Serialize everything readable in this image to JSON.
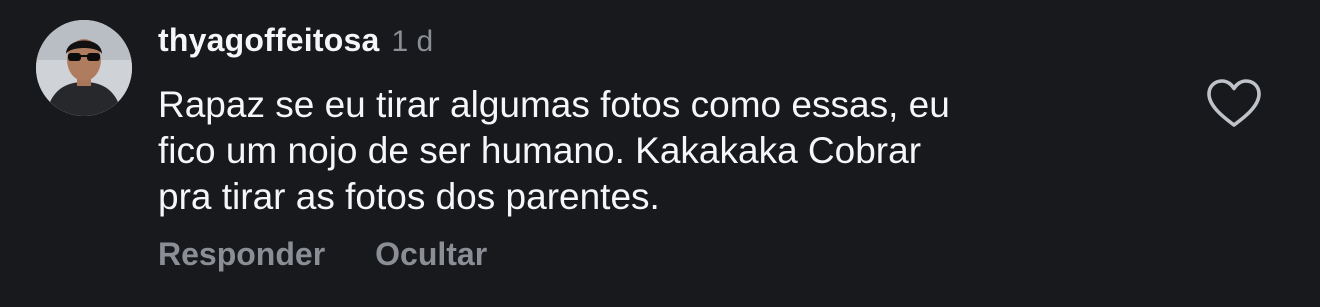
{
  "comment": {
    "username": "thyagoffeitosa",
    "time": "1 d",
    "text_lines": [
      "Rapaz se eu tirar algumas fotos como essas, eu",
      "fico um nojo de ser humano. Kakakaka Cobrar",
      "pra tirar as fotos dos parentes."
    ],
    "actions": {
      "reply_label": "Responder",
      "hide_label": "Ocultar"
    },
    "like_icon": "heart-outline-icon"
  },
  "colors": {
    "background": "#17191c",
    "primary_text": "#f5f6f7",
    "secondary_text": "#8b8e95"
  }
}
